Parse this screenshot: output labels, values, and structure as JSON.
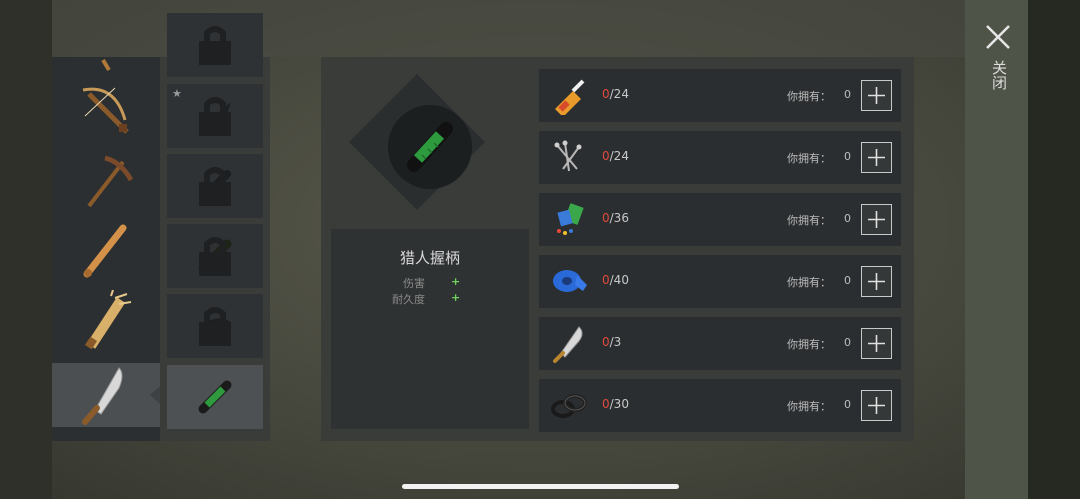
{
  "close": {
    "label": "关闭",
    "icon": "close-icon"
  },
  "weapons": [
    {
      "name": "partial-weapon-icon",
      "selected": false
    },
    {
      "name": "crossbow-icon",
      "selected": false
    },
    {
      "name": "pickaxe-icon",
      "selected": false
    },
    {
      "name": "baseball-bat-icon",
      "selected": false
    },
    {
      "name": "spiked-plank-icon",
      "selected": false
    },
    {
      "name": "machete-icon",
      "selected": true
    }
  ],
  "parts": [
    {
      "name": "partial-part-icon",
      "locked": true,
      "starred": false
    },
    {
      "name": "spike-blade-icon",
      "locked": true,
      "starred": true
    },
    {
      "name": "grip-silhouette-icon",
      "locked": true,
      "starred": false
    },
    {
      "name": "wrapped-grip-icon",
      "locked": true,
      "starred": false
    },
    {
      "name": "hand-guard-icon",
      "locked": true,
      "starred": false
    },
    {
      "name": "hunter-grip-icon",
      "locked": false,
      "starred": false,
      "selected": true
    }
  ],
  "detail": {
    "item_name": "猎人握柄",
    "stats": [
      {
        "label": "伤害",
        "value": "+"
      },
      {
        "label": "耐久度",
        "value": "+"
      }
    ]
  },
  "materials": [
    {
      "icon": "glue-icon",
      "have": "0",
      "need": "/24",
      "own_label": "你拥有：",
      "own_value": "0"
    },
    {
      "icon": "nails-icon",
      "have": "0",
      "need": "/24",
      "own_label": "你拥有：",
      "own_value": "0"
    },
    {
      "icon": "cloth-scraps-icon",
      "have": "0",
      "need": "/36",
      "own_label": "你拥有：",
      "own_value": "0"
    },
    {
      "icon": "duct-tape-icon",
      "have": "0",
      "need": "/40",
      "own_label": "你拥有：",
      "own_value": "0"
    },
    {
      "icon": "machete-blade-icon",
      "have": "0",
      "need": "/3",
      "own_label": "你拥有：",
      "own_value": "0"
    },
    {
      "icon": "rubber-rings-icon",
      "have": "0",
      "need": "/30",
      "own_label": "你拥有：",
      "own_value": "0"
    }
  ],
  "colors": {
    "missing": "#e04a3c",
    "stat_plus": "#6fd35a",
    "selected_bg": "#4b4f52"
  }
}
